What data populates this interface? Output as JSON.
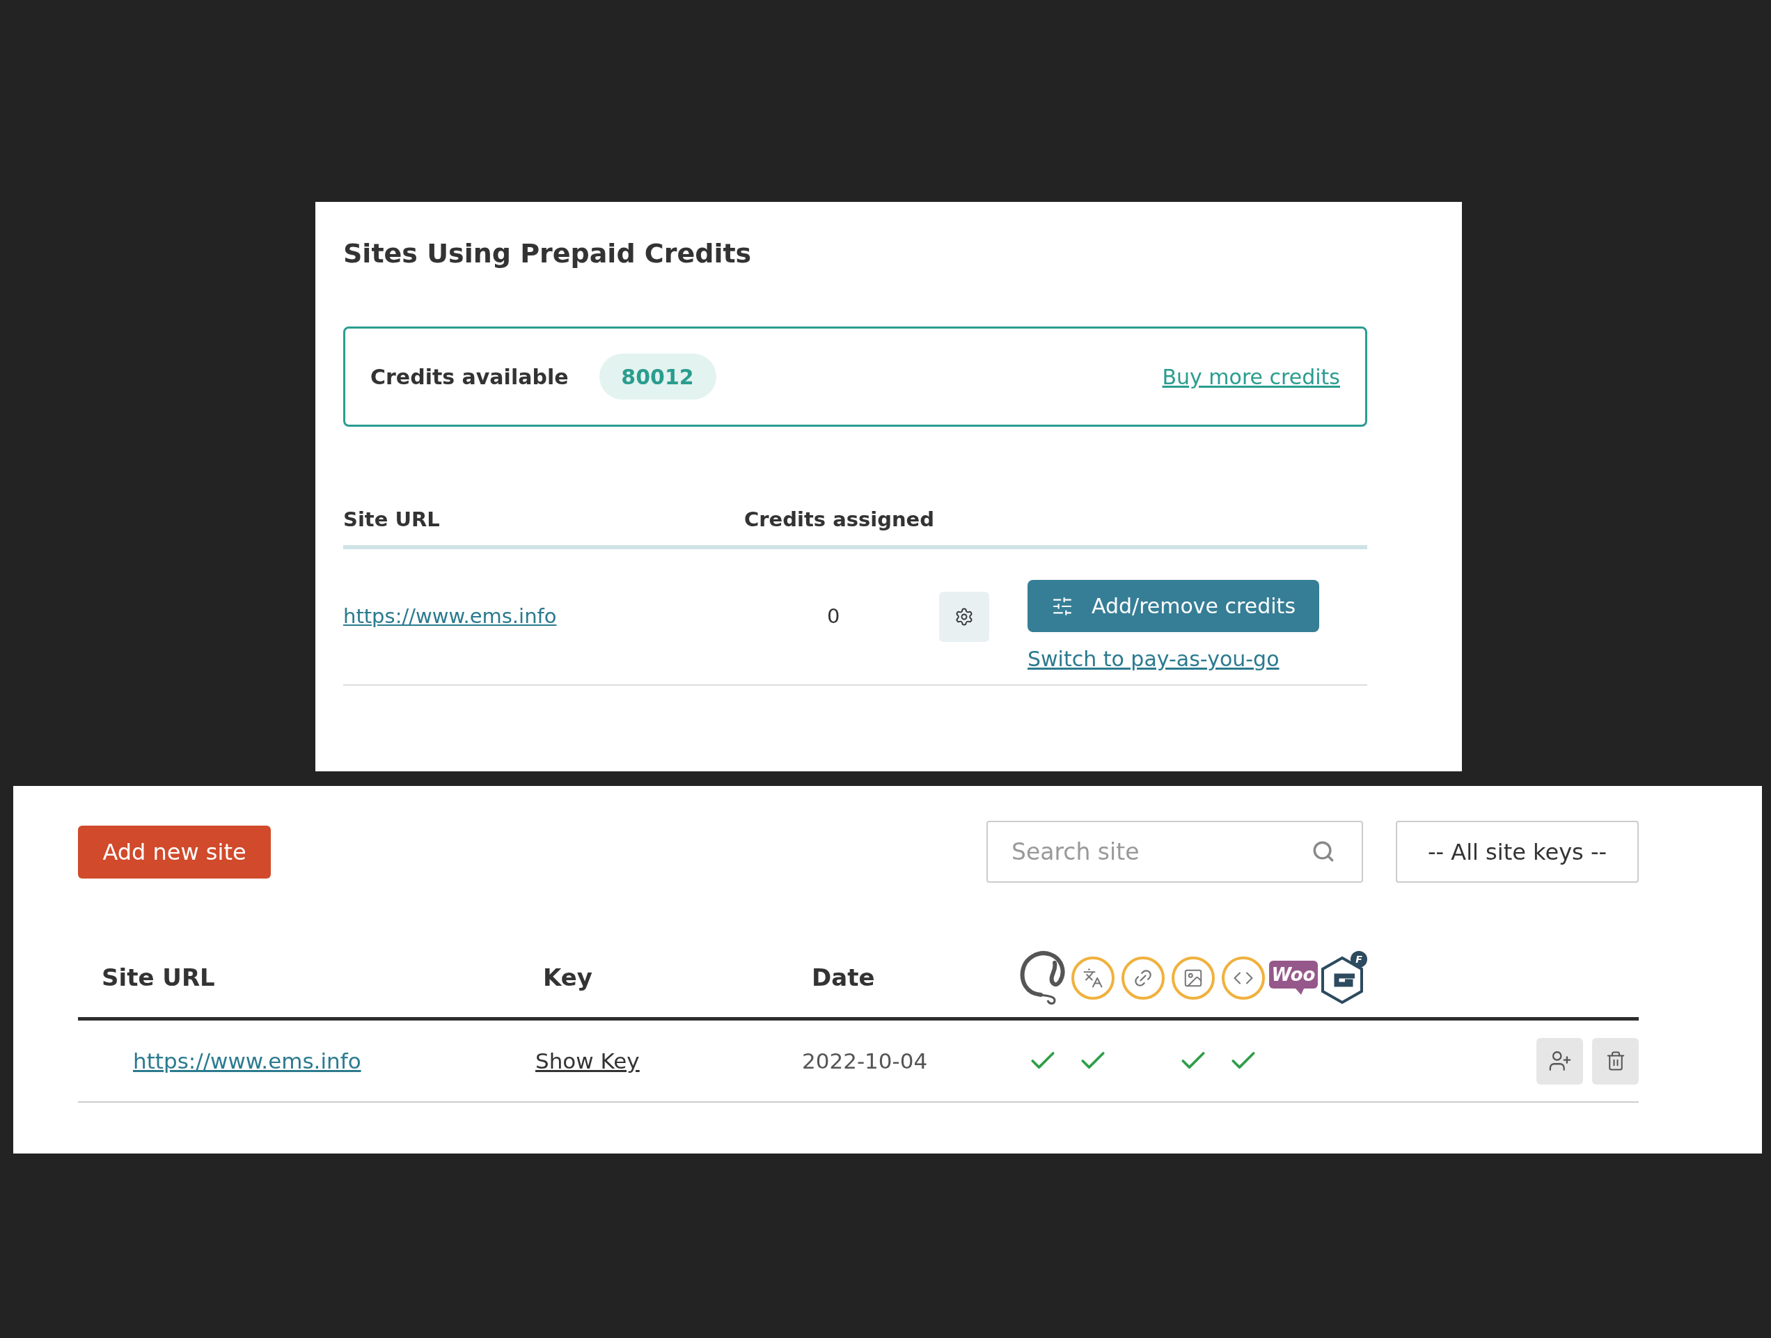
{
  "prepaid_panel": {
    "title": "Sites Using Prepaid Credits",
    "credits": {
      "label": "Credits available",
      "value": "80012",
      "link": "Buy more credits"
    },
    "table": {
      "columns": [
        "Site URL",
        "Credits assigned"
      ],
      "rows": [
        {
          "url": "https://www.ems.info",
          "credits": "0",
          "button": "Add/remove credits",
          "link": "Switch to pay-as-you-go"
        }
      ]
    }
  },
  "sites_panel": {
    "add_button": "Add new site",
    "search": {
      "placeholder": "Search site"
    },
    "key_filter": "-- All site keys --",
    "table": {
      "columns": [
        "Site URL",
        "Key",
        "Date"
      ],
      "feature_icons": [
        {
          "kind": "spiral"
        },
        {
          "kind": "translate"
        },
        {
          "kind": "link"
        },
        {
          "kind": "image"
        },
        {
          "kind": "code"
        },
        {
          "kind": "woo",
          "text": "Woo"
        },
        {
          "kind": "gravity",
          "text": "F"
        }
      ],
      "rows": [
        {
          "url": "https://www.ems.info",
          "key": "Show Key",
          "date": "2022-10-04",
          "features": [
            {
              "checked": true
            },
            {
              "checked": true
            },
            {
              "checked": false
            },
            {
              "checked": true
            },
            {
              "checked": true
            },
            {
              "checked": false
            },
            {
              "checked": false
            }
          ]
        }
      ]
    }
  }
}
